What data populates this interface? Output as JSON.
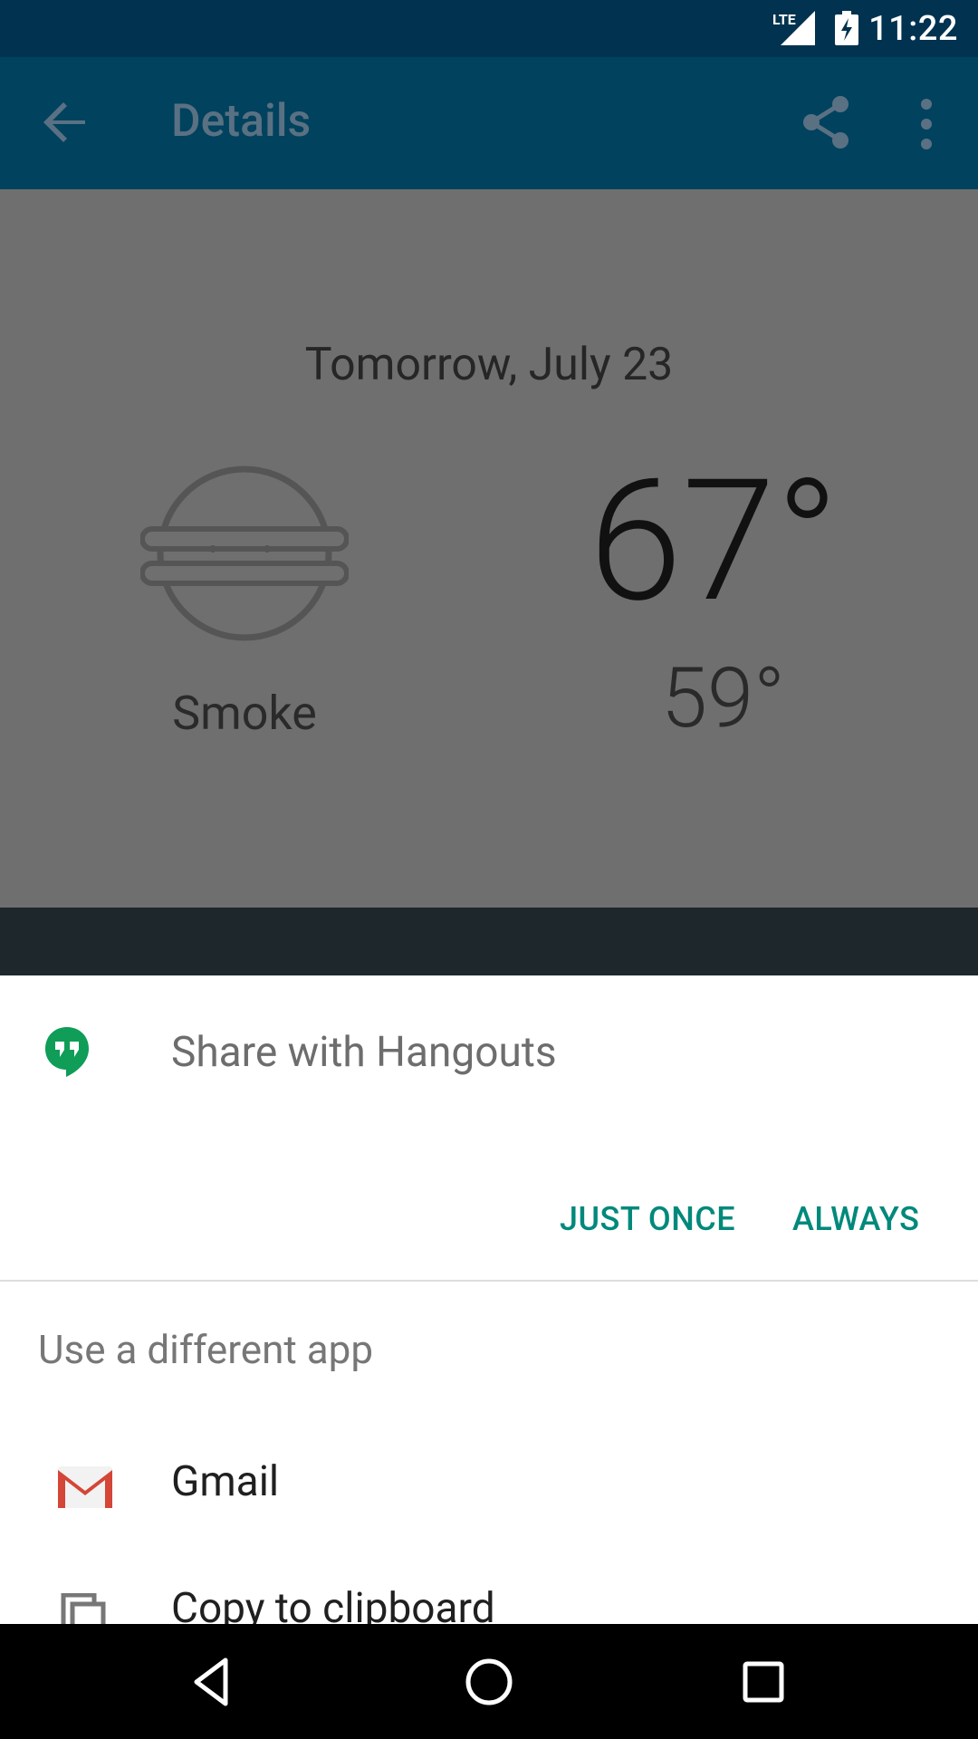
{
  "status_bar": {
    "network": "LTE",
    "time": "11:22"
  },
  "toolbar": {
    "title": "Details"
  },
  "details": {
    "date": "Tomorrow, July 23",
    "condition": "Smoke",
    "high": "67°",
    "low": "59°"
  },
  "share_sheet": {
    "default_app_label": "Share with Hangouts",
    "just_once_label": "JUST ONCE",
    "always_label": "ALWAYS",
    "different_app_label": "Use a different app",
    "apps": [
      {
        "label": "Gmail"
      },
      {
        "label": "Copy to clipboard"
      }
    ]
  },
  "colors": {
    "status_bar": "#01324f",
    "toolbar": "#01425e",
    "accent": "#00897b",
    "hangouts_green": "#0f9d58",
    "gmail_red": "#d44638"
  }
}
